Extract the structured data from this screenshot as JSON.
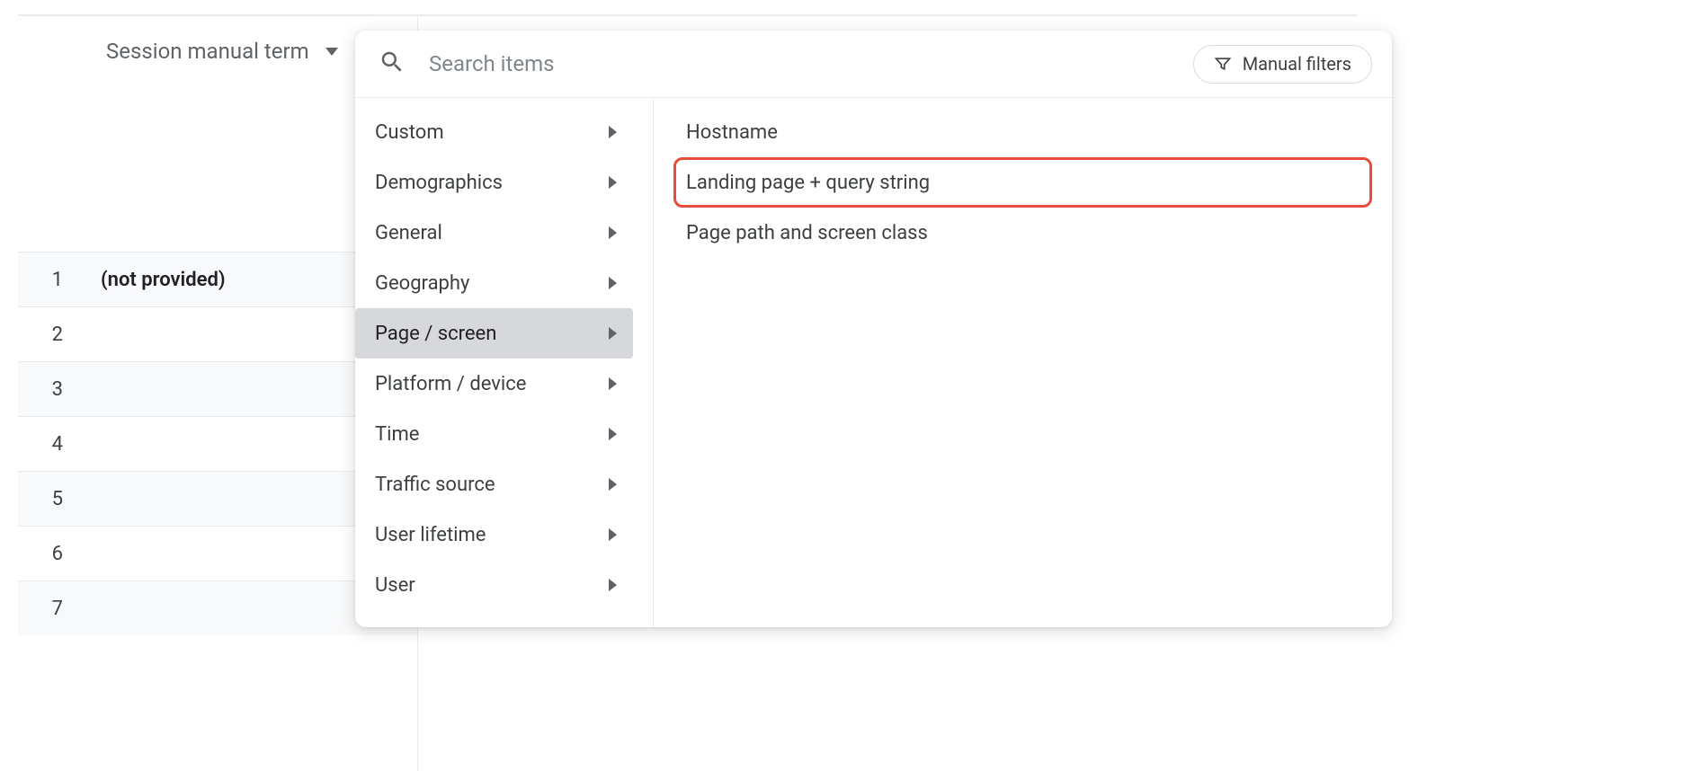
{
  "dimension": {
    "label": "Session manual term"
  },
  "table": {
    "rows": [
      {
        "num": "1",
        "value": "(not provided)"
      },
      {
        "num": "2",
        "value": ""
      },
      {
        "num": "3",
        "value": ""
      },
      {
        "num": "4",
        "value": ""
      },
      {
        "num": "5",
        "value": ""
      },
      {
        "num": "6",
        "value": ""
      },
      {
        "num": "7",
        "value": ""
      }
    ]
  },
  "popup": {
    "search_placeholder": "Search items",
    "filters_label": "Manual filters",
    "categories": [
      {
        "label": "Custom",
        "selected": false
      },
      {
        "label": "Demographics",
        "selected": false
      },
      {
        "label": "General",
        "selected": false
      },
      {
        "label": "Geography",
        "selected": false
      },
      {
        "label": "Page / screen",
        "selected": true
      },
      {
        "label": "Platform / device",
        "selected": false
      },
      {
        "label": "Time",
        "selected": false
      },
      {
        "label": "Traffic source",
        "selected": false
      },
      {
        "label": "User lifetime",
        "selected": false
      },
      {
        "label": "User",
        "selected": false
      }
    ],
    "sub_items": [
      {
        "label": "Hostname",
        "highlighted": false
      },
      {
        "label": "Landing page + query string",
        "highlighted": true
      },
      {
        "label": "Page path and screen class",
        "highlighted": false
      }
    ]
  }
}
